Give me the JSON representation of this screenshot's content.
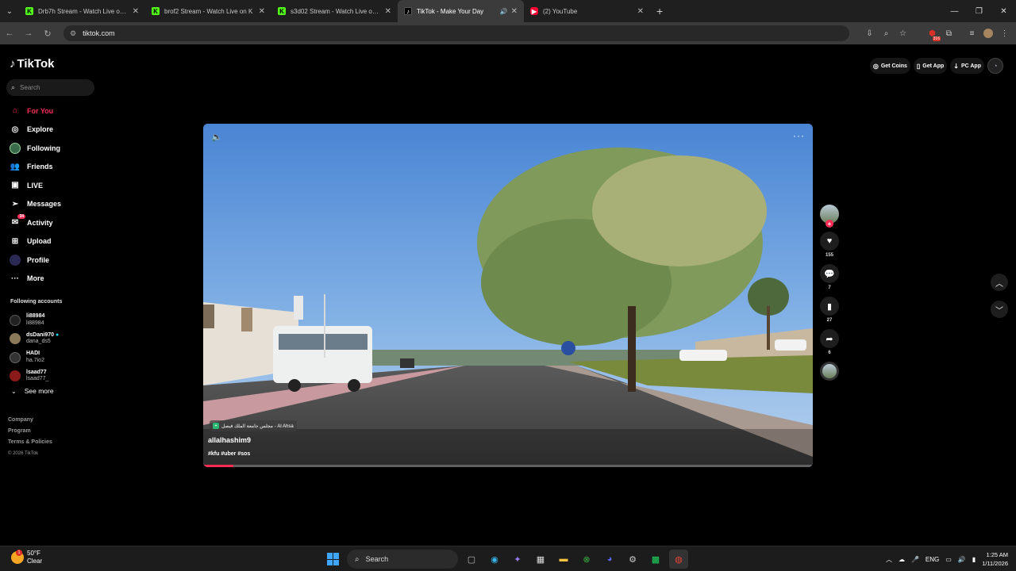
{
  "browser": {
    "tabs": [
      {
        "favicon": "kick",
        "title": "Drb7h Stream - Watch Live on K",
        "active": false
      },
      {
        "favicon": "kick",
        "title": "brof2 Stream - Watch Live on K",
        "active": false
      },
      {
        "favicon": "kick",
        "title": "s3d02 Stream - Watch Live on K",
        "active": false
      },
      {
        "favicon": "tiktok",
        "title": "TikTok - Make Your Day",
        "active": true
      },
      {
        "favicon": "youtube",
        "title": "(2) YouTube",
        "active": false
      }
    ],
    "url": "tiktok.com",
    "extension_badge": "316"
  },
  "sidebar": {
    "logo": "TikTok",
    "search_placeholder": "Search",
    "nav": [
      {
        "label": "For You",
        "icon": "home-icon",
        "active": true
      },
      {
        "label": "Explore",
        "icon": "compass-icon"
      },
      {
        "label": "Following",
        "icon": "following-avatar-icon"
      },
      {
        "label": "Friends",
        "icon": "friends-icon"
      },
      {
        "label": "LIVE",
        "icon": "live-icon"
      },
      {
        "label": "Messages",
        "icon": "send-icon"
      },
      {
        "label": "Activity",
        "icon": "inbox-icon",
        "badge": "34"
      },
      {
        "label": "Upload",
        "icon": "plus-square-icon"
      },
      {
        "label": "Profile",
        "icon": "profile-avatar-icon"
      },
      {
        "label": "More",
        "icon": "more-icon"
      }
    ],
    "following_title": "Following accounts",
    "accounts": [
      {
        "username": "li88984",
        "name": "li88984",
        "color": "#222"
      },
      {
        "username": "dsDani970",
        "name": "dana_ds5",
        "color": "#8a7a5a"
      },
      {
        "username": "HADI",
        "name": "ha.7io2",
        "color": "#333"
      },
      {
        "username": "lsaad77",
        "name": "lsaad77_",
        "color": "#8b1a1a"
      }
    ],
    "see_more": "See more",
    "footer": [
      "Company",
      "Program",
      "Terms & Policies"
    ],
    "copyright": "© 2026 TikTok"
  },
  "header": {
    "get_coins": "Get Coins",
    "get_app": "Get App",
    "pc_app": "PC App"
  },
  "video": {
    "location": "مجلس جامعة الملك فيصل - Al Ahsa",
    "author": "allalhashim9",
    "tags": "#kfu #uber #sos",
    "progress": 0.05
  },
  "actions": {
    "likes": "155",
    "comments": "7",
    "saves": "27",
    "shares": "6"
  },
  "taskbar": {
    "temp": "50°F",
    "condition": "Clear",
    "search": "Search",
    "lang": "ENG",
    "time": "1:25 AM",
    "date": "1/11/2026"
  },
  "colors": {
    "accent": "#fe2c55",
    "kick": "#53fc18"
  }
}
